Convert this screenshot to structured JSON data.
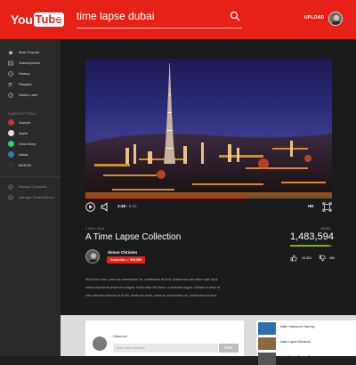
{
  "header": {
    "logo_you": "You",
    "logo_tube": "Tube",
    "search_query": "time lapse dubai",
    "upload_label": "UPLOAD"
  },
  "sidebar": {
    "items": [
      {
        "label": "Most Popular",
        "icon": "star-icon"
      },
      {
        "label": "Subscriptions",
        "icon": "subscriptions-icon"
      },
      {
        "label": "History",
        "icon": "history-icon"
      },
      {
        "label": "Playlists",
        "icon": "playlist-icon"
      },
      {
        "label": "Watch Later",
        "icon": "clock-icon"
      }
    ],
    "subscriptions_heading": "SUBSCRIPTIONS",
    "subscriptions": [
      {
        "label": "Joseph",
        "color": "#c0392b"
      },
      {
        "label": "Apple",
        "color": "#e0e0e0"
      },
      {
        "label": "Xbox Ahoy",
        "color": "#2ecc71"
      },
      {
        "label": "Nokia",
        "color": "#2980b9"
      },
      {
        "label": "MKBHD",
        "color": "#333333"
      }
    ],
    "footer_items": [
      {
        "label": "Browse Channels"
      },
      {
        "label": "Manage Subscriptions"
      }
    ]
  },
  "player": {
    "current_time": "3:49",
    "total_time": "/ 5:16",
    "quality_label": "HD",
    "progress_fraction": 0.65
  },
  "video": {
    "date": "2 NOV 2014",
    "title": "A Time Lapse Collection",
    "views_label": "VIEWS",
    "views": "1,483,594",
    "like_ratio": 0.93,
    "likes": "16,304",
    "dislikes": "284"
  },
  "channel": {
    "name": "Simon Christen",
    "subscribe_label": "Subscribe",
    "subscriber_count": "609,356"
  },
  "description": [
    "Morbi leo risus, porta ac consectetur ac, vestibulum at eros. Maecenas sed diam eget risus",
    "varius blandit sit amet non magna. Nulla vitae elit libero, a pharetra augue. Nullam id dolor id",
    "nibh ultricies vehicula ut id elit. Morbi leo risus, porta ac consectetur ac, vestibulum at eros."
  ],
  "comments": {
    "username": "UltraLine",
    "input_placeholder": "Enter your comment",
    "post_label": "POST"
  },
  "related": [
    {
      "title": "Justin Hollywood Starring",
      "color": "#2c6fb3"
    },
    {
      "title": "Justin Lapse Moments",
      "color": "#8a6a3a"
    },
    {
      "title": "Justin Porter Timber Timber",
      "color": "#555555"
    }
  ],
  "colors": {
    "brand": "#e62117",
    "like_bar": "#7ab800"
  }
}
